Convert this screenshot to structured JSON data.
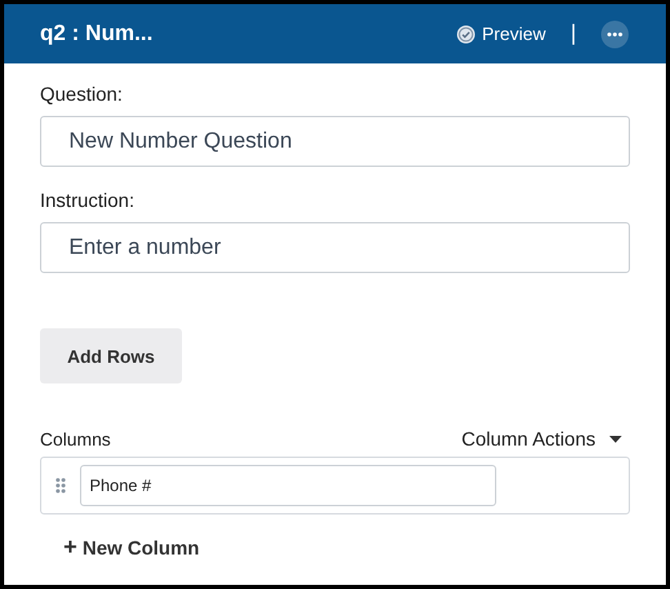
{
  "header": {
    "title": "q2 : Num...",
    "preview": "Preview",
    "separator": "|"
  },
  "fields": [
    {
      "label": "Question:",
      "value": "New Number Question"
    },
    {
      "label": "Instruction:",
      "value": "Enter a number"
    }
  ],
  "add_rows_button": "Add Rows",
  "columns": {
    "label": "Columns",
    "actions": "Column Actions",
    "items": [
      {
        "value": "Phone #"
      }
    ],
    "new_column": "New Column",
    "new_column_icon": "+"
  }
}
